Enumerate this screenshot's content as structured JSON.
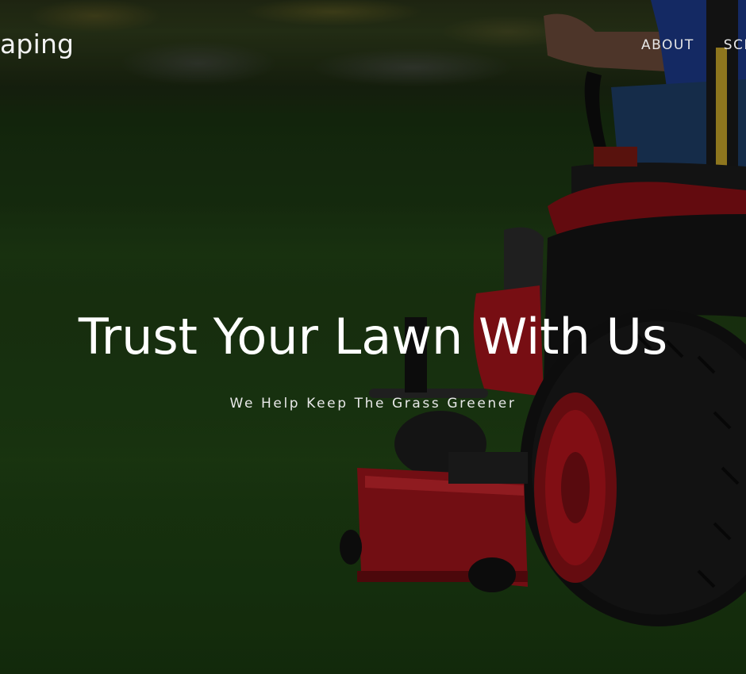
{
  "header": {
    "brand": "aping",
    "nav": [
      {
        "label": "ABOUT"
      },
      {
        "label": "SCH"
      }
    ]
  },
  "hero": {
    "title": "Trust Your Lawn With Us",
    "subtitle": "We Help Keep The Grass Greener"
  },
  "colors": {
    "text": "#ffffff",
    "mower_red": "#b3141c",
    "lawn_green": "#214415"
  }
}
